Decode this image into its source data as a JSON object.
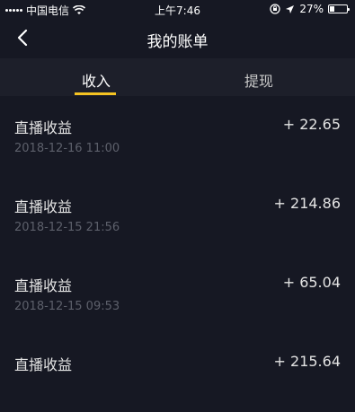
{
  "status_bar": {
    "carrier": "中国电信",
    "time": "上午7:46",
    "battery": "27%",
    "battery_level": 0.27
  },
  "header": {
    "title": "我的账单"
  },
  "tabs": [
    {
      "label": "收入",
      "selected": true
    },
    {
      "label": "提现",
      "selected": false
    }
  ],
  "accent_color": "#f5c322",
  "transactions": [
    {
      "title": "直播收益",
      "time": "2018-12-16 11:00",
      "amount": "+ 22.65"
    },
    {
      "title": "直播收益",
      "time": "2018-12-15 21:56",
      "amount": "+ 214.86"
    },
    {
      "title": "直播收益",
      "time": "2018-12-15 09:53",
      "amount": "+ 65.04"
    },
    {
      "title": "直播收益",
      "time": "",
      "amount": "+ 215.64"
    }
  ]
}
